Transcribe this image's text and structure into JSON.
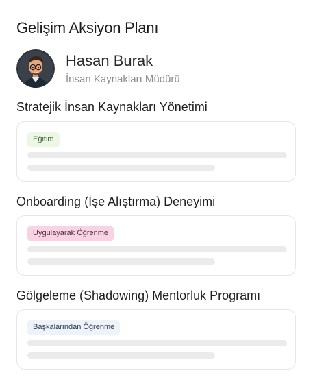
{
  "header": {
    "title": "Gelişim Aksiyon Planı"
  },
  "profile": {
    "name": "Hasan Burak",
    "role": "İnsan Kaynakları Müdürü",
    "avatar_icon": "cartoon-man-with-glasses-avatar"
  },
  "items": [
    {
      "title": "Stratejik İnsan Kaynakları Yönetimi",
      "tag": "Eğitim",
      "tag_bg": "#edf7e6",
      "tag_color": "#3c5a2a"
    },
    {
      "title": "Onboarding (İşe Alıştırma) Deneyimi",
      "tag": "Uygulayarak Öğrenme",
      "tag_bg": "#f7d3e3",
      "tag_color": "#5a2a3f"
    },
    {
      "title": "Gölgeleme (Shadowing) Mentorluk Programı",
      "tag": "Başkalarından Öğrenme",
      "tag_bg": "#eef3fa",
      "tag_color": "#2f3a4a"
    }
  ]
}
